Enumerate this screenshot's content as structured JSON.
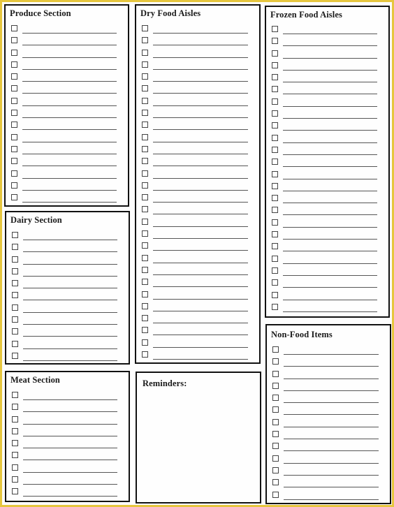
{
  "document": {
    "type": "Grocery shopping checklist",
    "frame_color": "#e6c63e",
    "border_color": "#111111"
  },
  "sections": {
    "produce": {
      "title": "Produce Section",
      "rows": 15
    },
    "dairy": {
      "title": "Dairy Section",
      "rows": 11
    },
    "meat": {
      "title": "Meat Section",
      "rows": 9
    },
    "dry_food": {
      "title": "Dry Food Aisles",
      "rows": 28
    },
    "reminders": {
      "title": "Reminders:"
    },
    "frozen_food": {
      "title": "Frozen Food Aisles",
      "rows": 24
    },
    "non_food": {
      "title": "Non-Food Items",
      "rows": 13
    }
  }
}
